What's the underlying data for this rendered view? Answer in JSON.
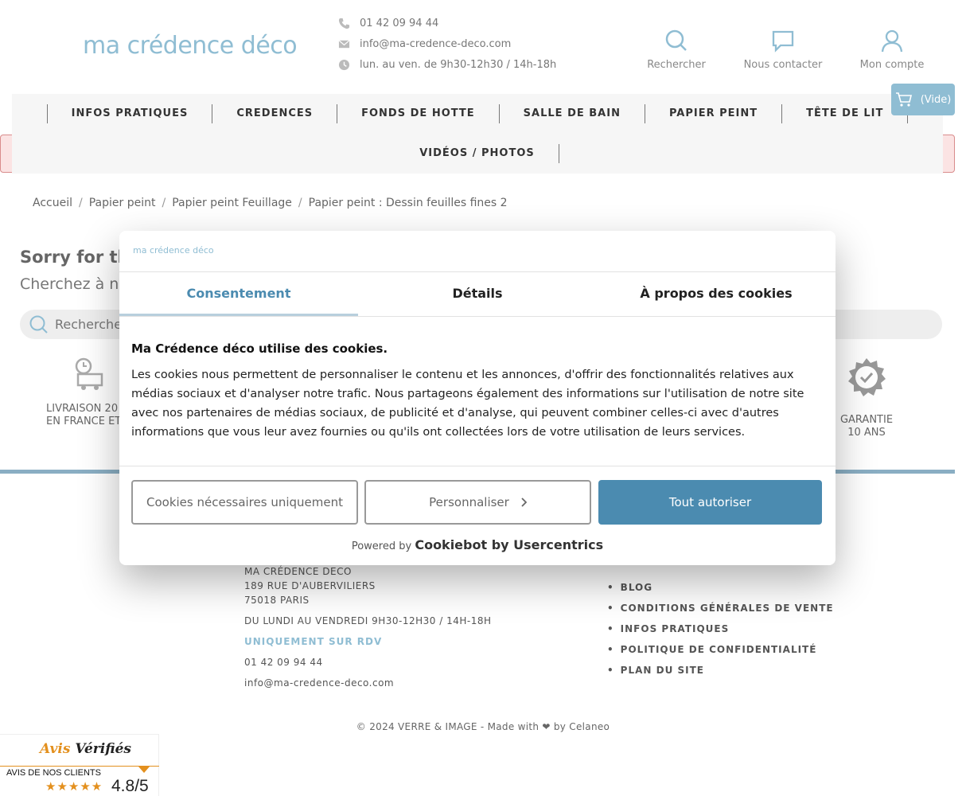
{
  "header": {
    "logo": "ma crédence déco",
    "phone": "01 42 09 94 44",
    "email": "info@ma-credence-deco.com",
    "hours": "lun. au ven. de 9h30-12h30 / 14h-18h",
    "actions": {
      "search": "Rechercher",
      "contact": "Nous contacter",
      "account": "Mon compte"
    },
    "cart": "(Vide)"
  },
  "nav": {
    "row1": [
      "INFOS PRATIQUES",
      "CREDENCES",
      "FONDS DE HOTTE",
      "SALLE DE BAIN",
      "PAPIER PEINT",
      "TÊTE DE LIT"
    ],
    "row2": [
      "VIDÉOS / PHOTOS"
    ]
  },
  "breadcrumb": [
    "Accueil",
    "Papier peint",
    "Papier peint  Feuillage",
    "Papier peint : Dessin feuilles fines 2"
  ],
  "content": {
    "sorry": "Sorry for the",
    "search_hint": "Cherchez à no",
    "search_placeholder": "Rechercher"
  },
  "features": {
    "delivery_l1": "LIVRAISON 20",
    "delivery_l2": "EN FRANCE ET",
    "warranty_l1": "GARANTIE",
    "warranty_l2": "10 ANS"
  },
  "footer": {
    "address": [
      "MA CRÉDENCE DECO",
      "189 RUE D'AUBERVILIERS",
      "75018 PARIS"
    ],
    "hours": "DU LUNDI AU VENDREDI 9H30-12H30 / 14H-18H",
    "rdv": "UNIQUEMENT SUR RDV",
    "phone": "01 42 09 94 44",
    "email": "info@ma-credence-deco.com",
    "links": [
      "BLOG",
      "CONDITIONS GÉNÉRALES DE VENTE",
      "INFOS PRATIQUES",
      "POLITIQUE DE CONFIDENTIALITÉ",
      "PLAN DU SITE"
    ],
    "copyright": "© 2024 VERRE & IMAGE - Made with ❤ by Celaneo"
  },
  "avis": {
    "brand_a": "Avis",
    "brand_b": "Vérifiés",
    "caption": "AVIS DE NOS CLIENTS",
    "stars": "★★★★★",
    "score": "4.8/5"
  },
  "cookie_dialog": {
    "logo": "ma crédence déco",
    "tabs": [
      "Consentement",
      "Détails",
      "À propos des cookies"
    ],
    "title": "Ma Crédence déco utilise des cookies.",
    "text": "Les cookies nous permettent de personnaliser le contenu et les annonces, d'offrir des fonctionnalités relatives aux médias sociaux et d'analyser notre trafic. Nous partageons également des informations sur l'utilisation de notre site avec nos partenaires de médias sociaux, de publicité et d'analyse, qui peuvent combiner celles-ci avec d'autres informations que vous leur avez fournies ou qu'ils ont collectées lors de votre utilisation de leurs services.",
    "btn_necessary": "Cookies nécessaires uniquement",
    "btn_customize": "Personnaliser",
    "btn_accept": "Tout autoriser",
    "powered_prefix": "Powered by",
    "powered_brand": "Cookiebot by Usercentrics"
  },
  "colors": {
    "brand": "#8fbdd3",
    "accent": "#4b8bb0",
    "nav_bg": "#f6f6f6"
  }
}
